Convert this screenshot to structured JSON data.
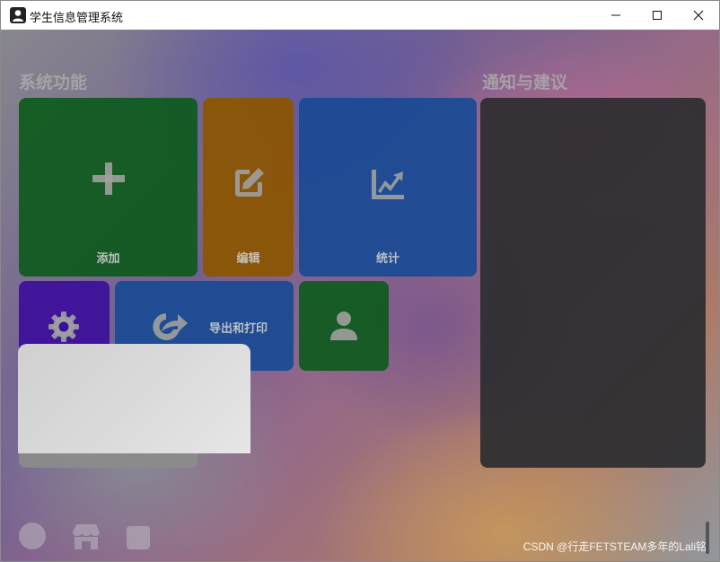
{
  "window": {
    "title": "学生信息管理系统",
    "controls": {
      "minimize": "minimize",
      "maximize": "maximize",
      "close": "close"
    }
  },
  "sections": {
    "functions_title": "系统功能",
    "notice_title": "通知与建议"
  },
  "tiles": {
    "add": {
      "label": "添加",
      "color": "#0f5a1e",
      "icon": "plus-icon"
    },
    "edit": {
      "label": "编辑",
      "color": "#8a5500",
      "icon": "edit-icon"
    },
    "stats": {
      "label": "统计",
      "color": "#1a4a93",
      "icon": "chart-icon"
    },
    "settings": {
      "label": "",
      "color": "#3c0f9a",
      "icon": "gear-icon"
    },
    "export": {
      "label": "导出和打印",
      "color": "#1a4a93",
      "icon": "share-icon"
    },
    "user": {
      "label": "",
      "color": "#0f5a1e",
      "icon": "person-icon"
    }
  },
  "bottom_icons": [
    "circle-icon",
    "store-icon",
    "square-icon"
  ],
  "watermark": "CSDN @行走FETSTEAM多年的Lali铭"
}
